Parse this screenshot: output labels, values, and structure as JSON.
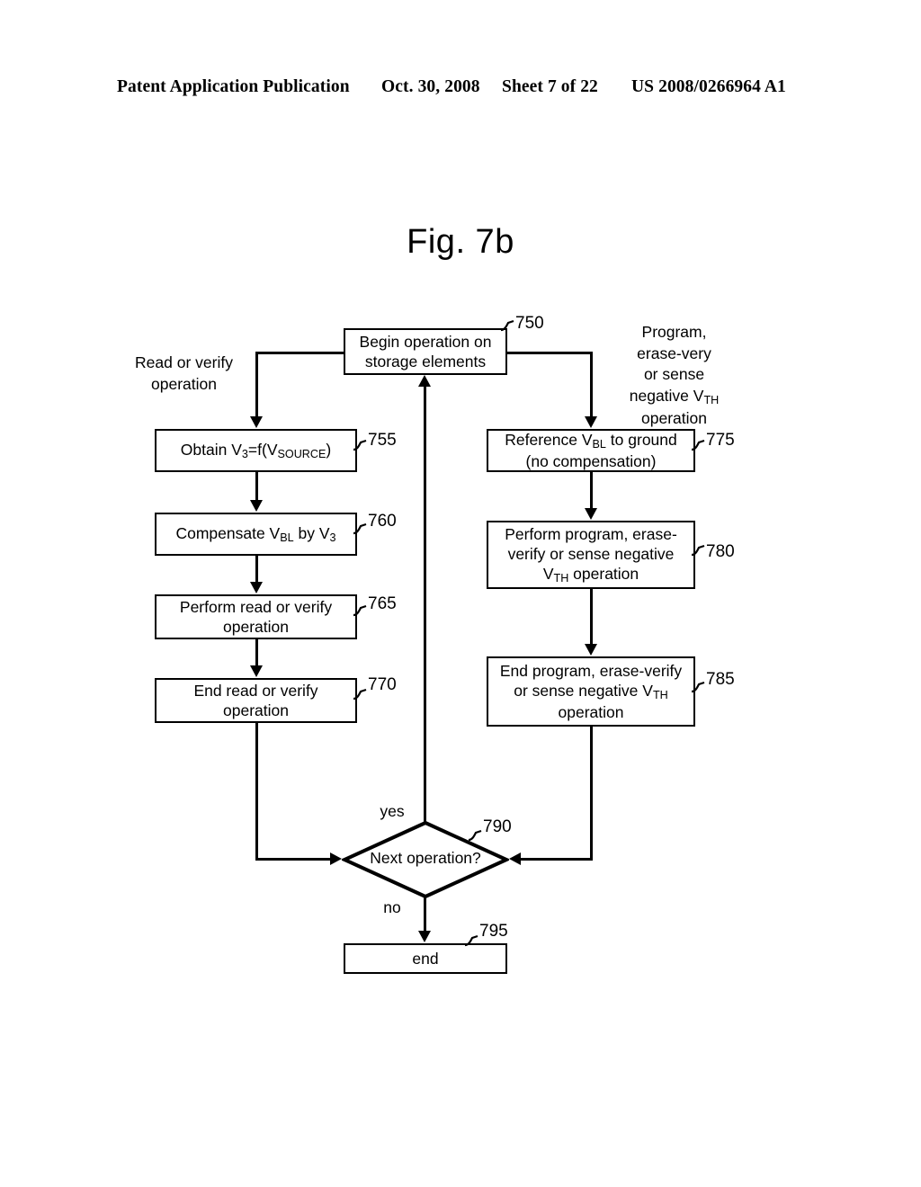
{
  "header": {
    "left": "Patent Application Publication",
    "date": "Oct. 30, 2008",
    "sheet": "Sheet 7 of 22",
    "number": "US 2008/0266964 A1"
  },
  "figure": {
    "title": "Fig. 7b"
  },
  "flowchart": {
    "branch_labels": {
      "left": "Read or verify\noperation",
      "left_line1": "Read or verify",
      "left_line2": "operation",
      "right_line1": "Program,",
      "right_line2": "erase-very",
      "right_line3": "or sense",
      "right_line4": "negative V",
      "right_line4_sub": "TH",
      "right_line5": "operation"
    },
    "nodes": [
      {
        "id": "750",
        "ref": "750",
        "type": "process",
        "line1": "Begin operation on",
        "line2": "storage elements"
      },
      {
        "id": "755",
        "ref": "755",
        "type": "process",
        "text_prefix": "Obtain V",
        "text_sub1": "3",
        "text_mid": "=f(V",
        "text_sub2": "SOURCE",
        "text_suffix": ")"
      },
      {
        "id": "760",
        "ref": "760",
        "type": "process",
        "text_prefix": "Compensate V",
        "text_sub1": "BL",
        "text_mid": " by V",
        "text_sub2": "3",
        "text_suffix": ""
      },
      {
        "id": "765",
        "ref": "765",
        "type": "process",
        "line1": "Perform read or verify",
        "line2": "operation"
      },
      {
        "id": "770",
        "ref": "770",
        "type": "process",
        "line1": "End read or verify",
        "line2": "operation"
      },
      {
        "id": "775",
        "ref": "775",
        "type": "process",
        "line1_prefix": "Reference V",
        "line1_sub": "BL",
        "line1_suffix": " to ground",
        "line2": "(no compensation)"
      },
      {
        "id": "780",
        "ref": "780",
        "type": "process",
        "line1": "Perform program, erase-",
        "line2": "verify or sense negative",
        "line3_prefix": "V",
        "line3_sub": "TH",
        "line3_suffix": " operation"
      },
      {
        "id": "785",
        "ref": "785",
        "type": "process",
        "line1": "End program, erase-verify",
        "line2_prefix": "or sense negative V",
        "line2_sub": "TH",
        "line3": "operation"
      },
      {
        "id": "790",
        "ref": "790",
        "type": "decision",
        "text": "Next operation?",
        "yes_label": "yes",
        "no_label": "no"
      },
      {
        "id": "795",
        "ref": "795",
        "type": "terminal",
        "text": "end"
      }
    ]
  },
  "colors": {
    "ink": "#000000",
    "paper": "#ffffff"
  }
}
